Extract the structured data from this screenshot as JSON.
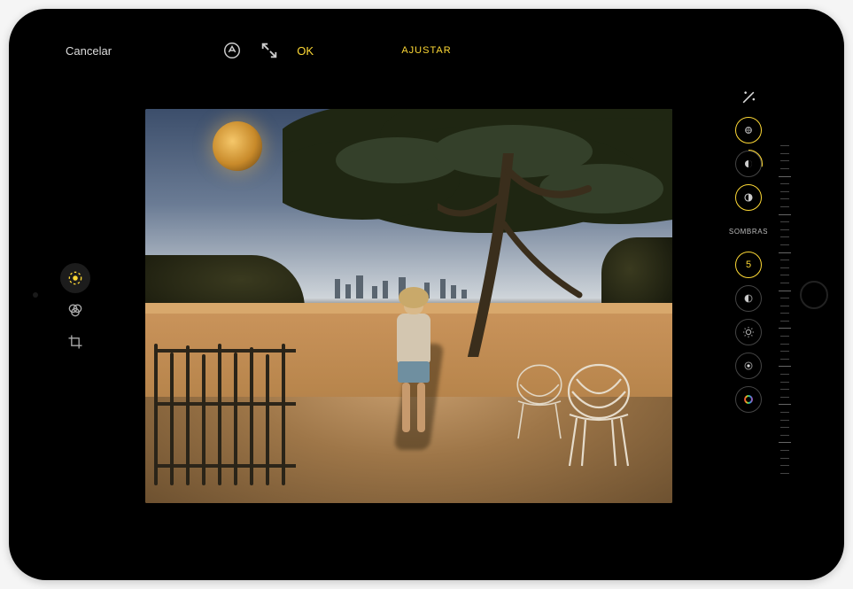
{
  "topbar": {
    "cancel_label": "Cancelar",
    "title": "AJUSTAR",
    "done_label": "OK"
  },
  "left_tools": {
    "adjust": "adjust",
    "filters": "filters",
    "crop": "crop"
  },
  "adjustments": {
    "current_label": "SOMBRAS",
    "current_value": "5"
  },
  "colors": {
    "accent": "#fdd835"
  }
}
